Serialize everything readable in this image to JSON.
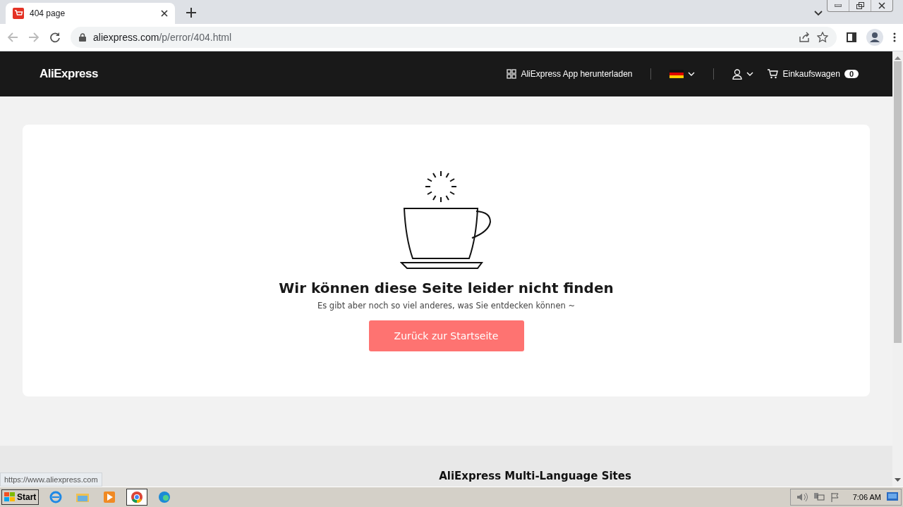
{
  "browser": {
    "tab": {
      "title": "404 page",
      "selected": true
    },
    "url_host": "aliexpress.com",
    "url_path": "/p/error/404.html"
  },
  "header": {
    "logo": "AliExpress",
    "app_download": "AliExpress App herunterladen",
    "cart": {
      "label": "Einkaufswagen",
      "count": "0"
    }
  },
  "error": {
    "title": "Wir können diese Seite leider nicht finden",
    "subtitle": "Es gibt aber noch so viel anderes, was Sie entdecken können ~",
    "button": "Zurück zur Startseite"
  },
  "footer": {
    "heading": "AliExpress Multi-Language Sites"
  },
  "status_url": "https://www.aliexpress.com",
  "taskbar": {
    "start": "Start",
    "clock": "7:06 AM"
  }
}
